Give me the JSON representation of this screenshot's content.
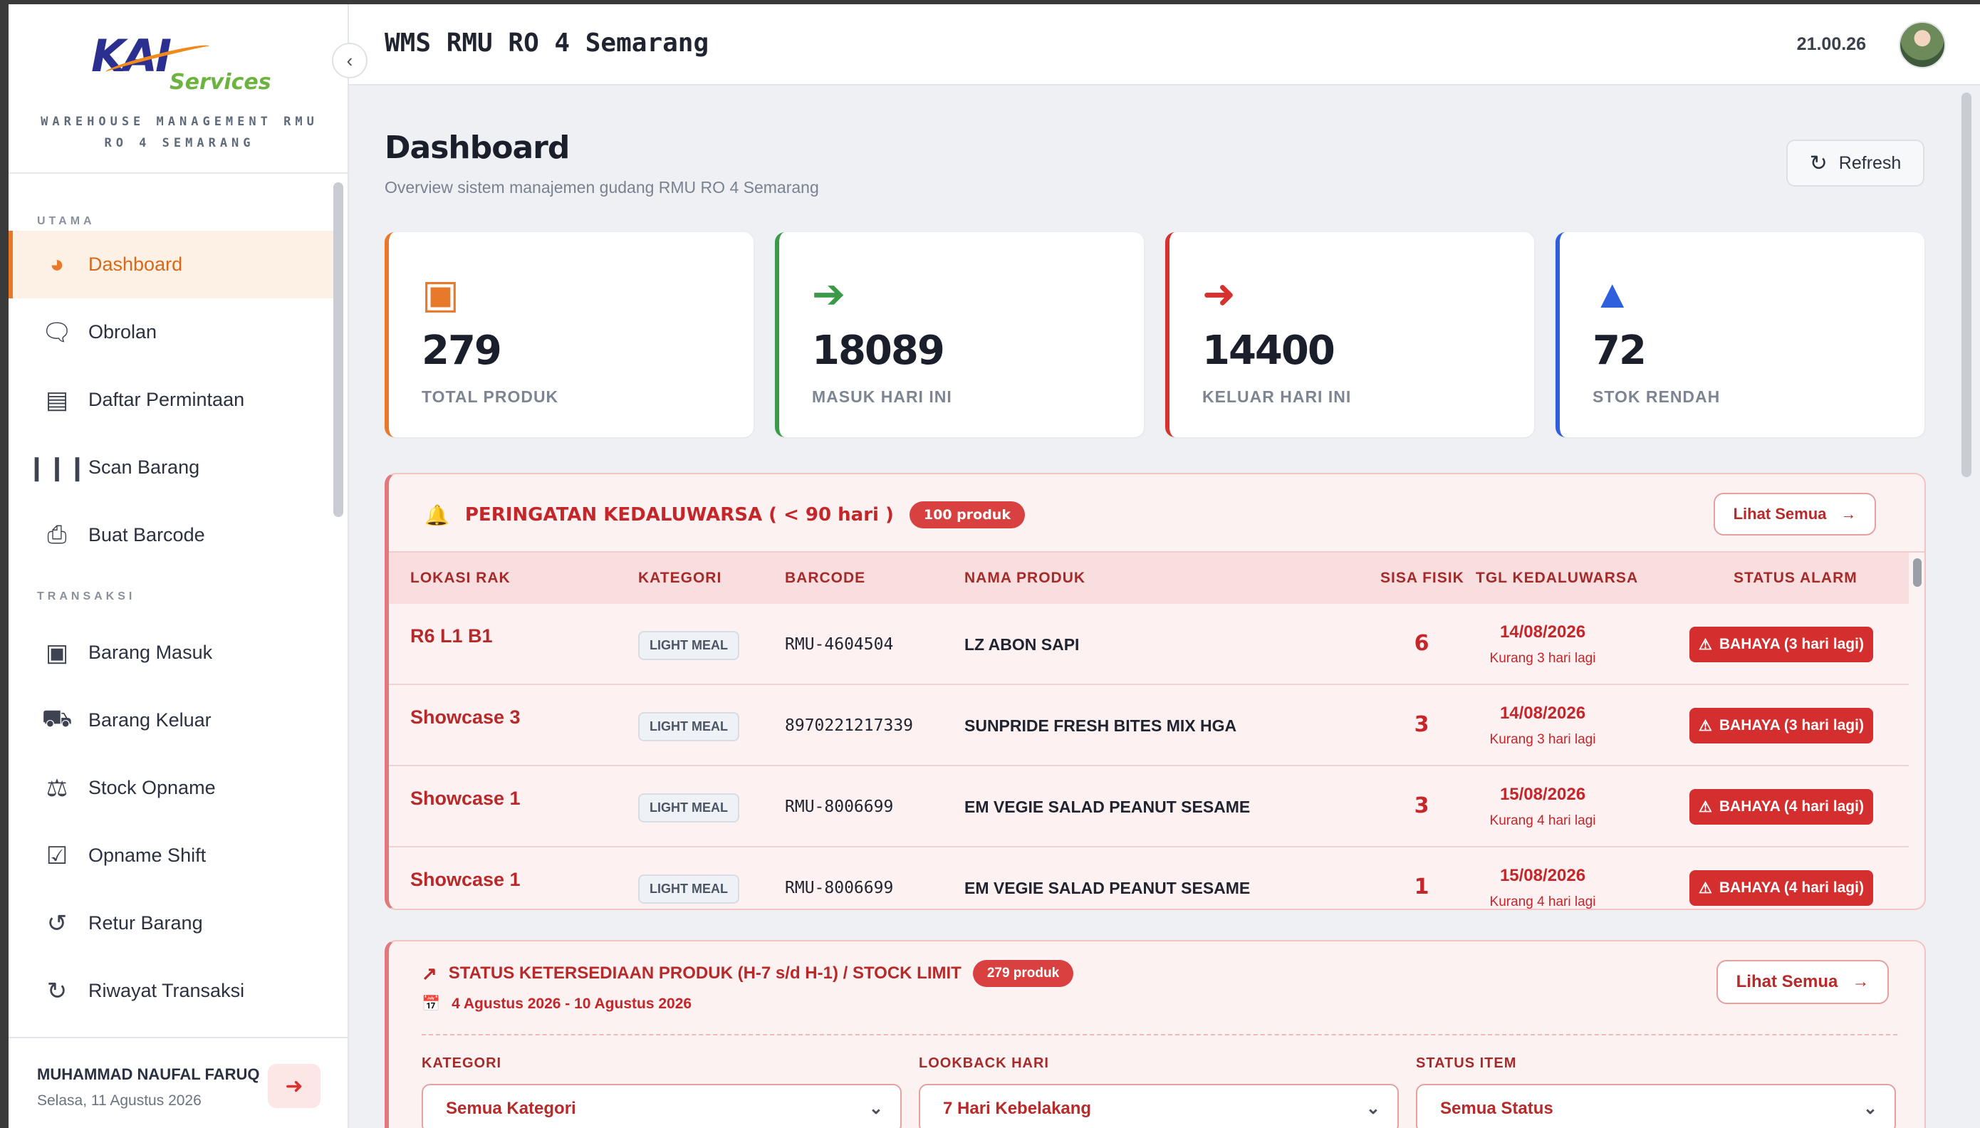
{
  "brand": {
    "logo_main": "KAI",
    "logo_sub": "Services",
    "subtitle": "WAREHOUSE MANAGEMENT RMU RO 4 SEMARANG"
  },
  "sidebar": {
    "sections": [
      {
        "label": "UTAMA"
      },
      {
        "label": "TRANSAKSI"
      }
    ],
    "items_main": [
      {
        "label": "Dashboard",
        "icon": "dashboard-gauge-icon",
        "active": true
      },
      {
        "label": "Obrolan",
        "icon": "chat-icon"
      },
      {
        "label": "Daftar Permintaan",
        "icon": "clipboard-list-icon"
      },
      {
        "label": "Scan Barang",
        "icon": "barcode-icon"
      },
      {
        "label": "Buat Barcode",
        "icon": "printer-icon"
      }
    ],
    "items_trans": [
      {
        "label": "Barang Masuk",
        "icon": "box-in-icon"
      },
      {
        "label": "Barang Keluar",
        "icon": "truck-icon"
      },
      {
        "label": "Stock Opname",
        "icon": "scale-icon"
      },
      {
        "label": "Opname Shift",
        "icon": "clipboard-check-icon"
      },
      {
        "label": "Retur Barang",
        "icon": "undo-icon"
      },
      {
        "label": "Riwayat Transaksi",
        "icon": "history-icon"
      }
    ],
    "user": {
      "name": "MUHAMMAD NAUFAL FARUQ",
      "date": "Selasa, 11 Agustus 2026"
    }
  },
  "header": {
    "title": "WMS RMU RO 4 Semarang",
    "clock": "21.00.26"
  },
  "page": {
    "title": "Dashboard",
    "subtitle": "Overview sistem manajemen gudang RMU RO 4 Semarang",
    "refresh_label": "Refresh"
  },
  "stats": [
    {
      "value": "279",
      "label": "TOTAL PRODUK",
      "icon": "boxes-icon",
      "color": "#e8782a"
    },
    {
      "value": "18089",
      "label": "MASUK HARI INI",
      "icon": "sign-in-icon",
      "color": "#3a9a48"
    },
    {
      "value": "14400",
      "label": "KELUAR HARI INI",
      "icon": "sign-out-icon",
      "color": "#d6322f"
    },
    {
      "value": "72",
      "label": "STOK RENDAH",
      "icon": "warning-triangle-icon",
      "color": "#2f5fdc"
    }
  ],
  "expiry": {
    "title": "PERINGATAN KEDALUWARSA ( < 90 hari )",
    "badge": "100 produk",
    "view_all": "Lihat Semua",
    "columns": [
      "LOKASI RAK",
      "KATEGORI",
      "BARCODE",
      "NAMA PRODUK",
      "SISA FISIK",
      "TGL KEDALUWARSA",
      "STATUS ALARM"
    ],
    "rows": [
      {
        "loc": "R6 L1 B1",
        "cat": "LIGHT MEAL",
        "barcode": "RMU-4604504",
        "name": "LZ ABON SAPI",
        "qty": "6",
        "date": "14/08/2026",
        "remaining": "Kurang 3 hari lagi",
        "status": "BAHAYA (3 hari lagi)"
      },
      {
        "loc": "Showcase 3",
        "cat": "LIGHT MEAL",
        "barcode": "8970221217339",
        "name": "SUNPRIDE FRESH BITES MIX HGA",
        "qty": "3",
        "date": "14/08/2026",
        "remaining": "Kurang 3 hari lagi",
        "status": "BAHAYA (3 hari lagi)"
      },
      {
        "loc": "Showcase 1",
        "cat": "LIGHT MEAL",
        "barcode": "RMU-8006699",
        "name": "EM VEGIE SALAD PEANUT SESAME",
        "qty": "3",
        "date": "15/08/2026",
        "remaining": "Kurang 4 hari lagi",
        "status": "BAHAYA (4 hari lagi)"
      },
      {
        "loc": "Showcase 1",
        "cat": "LIGHT MEAL",
        "barcode": "RMU-8006699",
        "name": "EM VEGIE SALAD PEANUT SESAME",
        "qty": "1",
        "date": "15/08/2026",
        "remaining": "Kurang 4 hari lagi",
        "status": "BAHAYA (4 hari lagi)"
      }
    ]
  },
  "availability": {
    "title": "STATUS KETERSEDIAAN PRODUK (H-7 s/d H-1) / STOCK LIMIT",
    "badge": "279 produk",
    "date_range": "4 Agustus 2026 - 10 Agustus 2026",
    "view_all": "Lihat Semua",
    "filters": [
      {
        "label": "KATEGORI",
        "value": "Semua Kategori"
      },
      {
        "label": "LOOKBACK HARI",
        "value": "7 Hari Kebelakang"
      },
      {
        "label": "STATUS ITEM",
        "value": "Semua Status"
      }
    ]
  }
}
